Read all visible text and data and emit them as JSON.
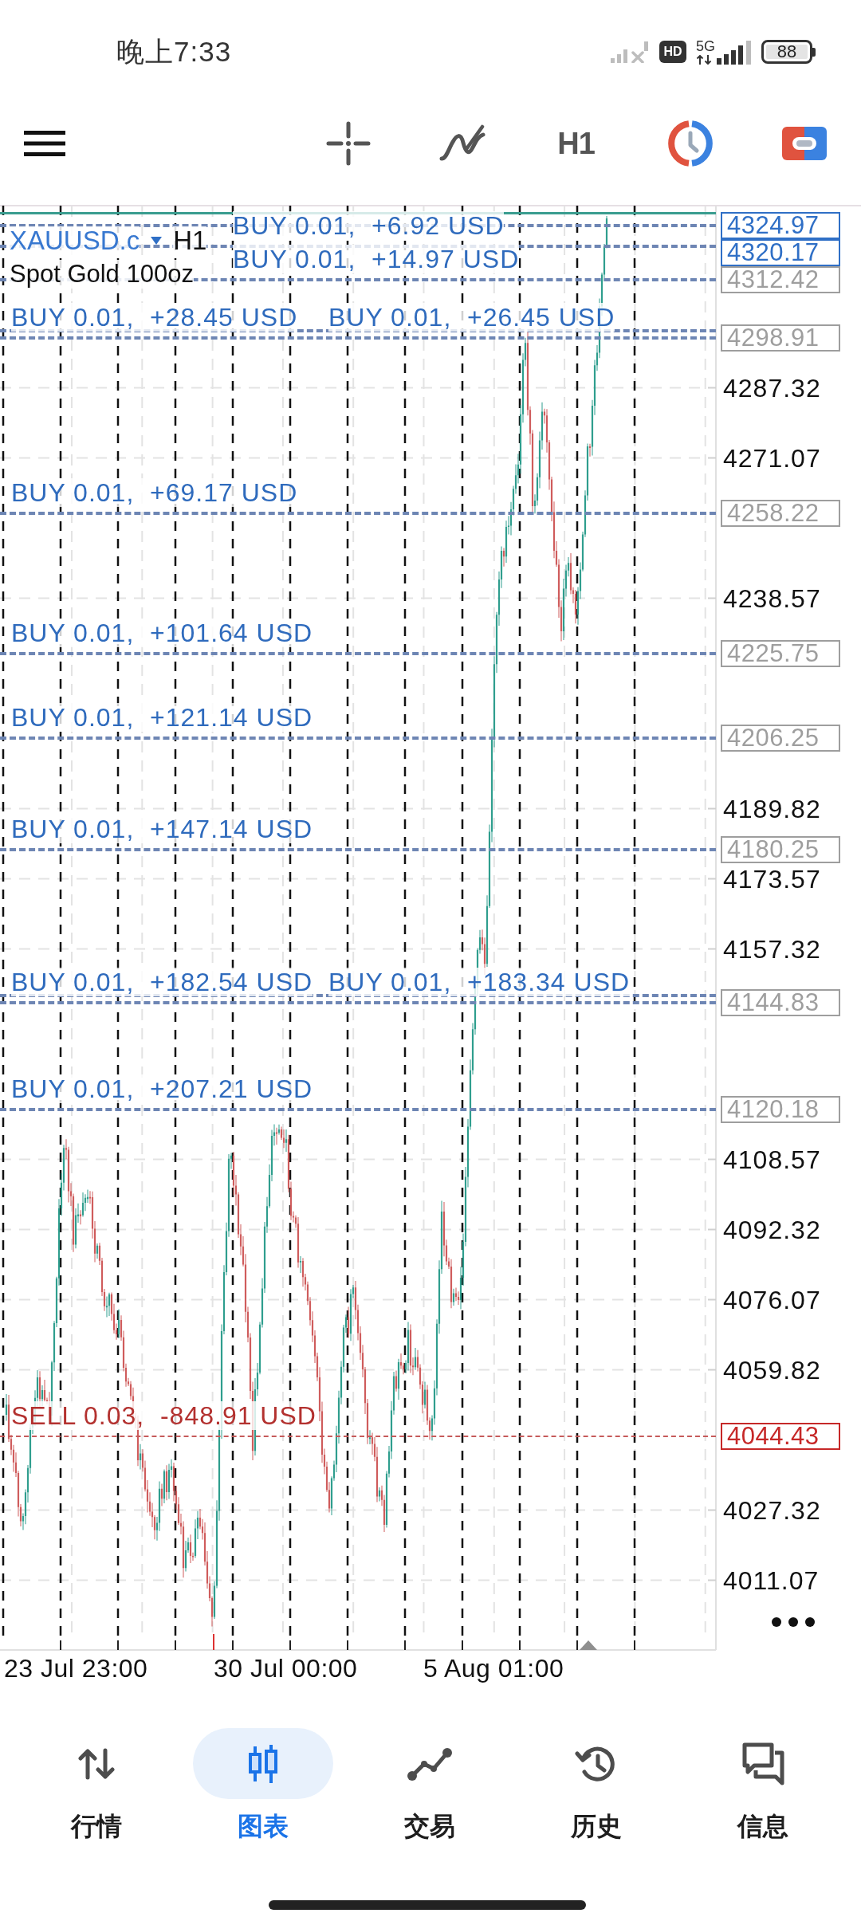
{
  "status_bar": {
    "time": "晚上7:33",
    "hd": "HD",
    "network": "5G",
    "battery": "88"
  },
  "toolbar": {
    "timeframe": "H1"
  },
  "chart": {
    "symbol": "XAUUSD.c",
    "timeframe": "H1",
    "description": "Spot Gold 100oz",
    "price_lines": [
      {
        "kind": "buy",
        "price": "4324.97",
        "color": "#2f6fc6"
      },
      {
        "kind": "buy",
        "price": "4320.17",
        "color": "#2f6fc6",
        "label": "BUY 0.01,  +6.92 USD"
      },
      {
        "kind": "buy",
        "price": "4312.42",
        "color": "#9e9e9e",
        "label": "BUY 0.01,  +14.97 USD"
      },
      {
        "kind": "buy",
        "price": "4298.91",
        "color": "#9e9e9e",
        "label": "BUY 0.01,  +28.45 USD",
        "twin_label": "BUY 0.01,  +26.45 USD"
      },
      {
        "kind": "buy",
        "price": "4258.22",
        "color": "#9e9e9e",
        "label": "BUY 0.01,  +69.17 USD"
      },
      {
        "kind": "buy",
        "price": "4225.75",
        "color": "#9e9e9e",
        "label": "BUY 0.01,  +101.64 USD"
      },
      {
        "kind": "buy",
        "price": "4206.25",
        "color": "#9e9e9e",
        "label": "BUY 0.01,  +121.14 USD"
      },
      {
        "kind": "buy",
        "price": "4180.25",
        "color": "#9e9e9e",
        "label": "BUY 0.01,  +147.14 USD"
      },
      {
        "kind": "buy",
        "price": "4144.83",
        "color": "#9e9e9e",
        "label": "BUY 0.01,  +182.54 USD",
        "twin_label": "BUY 0.01,  +183.34 USD"
      },
      {
        "kind": "buy",
        "price": "4120.18",
        "color": "#9e9e9e",
        "label": "BUY 0.01,  +207.21 USD"
      },
      {
        "kind": "sell",
        "price": "4044.43",
        "color": "#c62828",
        "label": "SELL 0.03,  -848.91 USD"
      }
    ],
    "price_ticks": [
      "4287.32",
      "4271.07",
      "4238.57",
      "4189.82",
      "4173.57",
      "4157.32",
      "4108.57",
      "4092.32",
      "4076.07",
      "4059.82",
      "4027.32",
      "4011.07"
    ],
    "time_labels": [
      "23 Jul 23:00",
      "30 Jul 00:00",
      "5 Aug 01:00"
    ]
  },
  "nav": [
    {
      "label": "行情",
      "selected": false
    },
    {
      "label": "图表",
      "selected": true
    },
    {
      "label": "交易",
      "selected": false
    },
    {
      "label": "历史",
      "selected": false
    },
    {
      "label": "信息",
      "selected": false
    }
  ]
}
